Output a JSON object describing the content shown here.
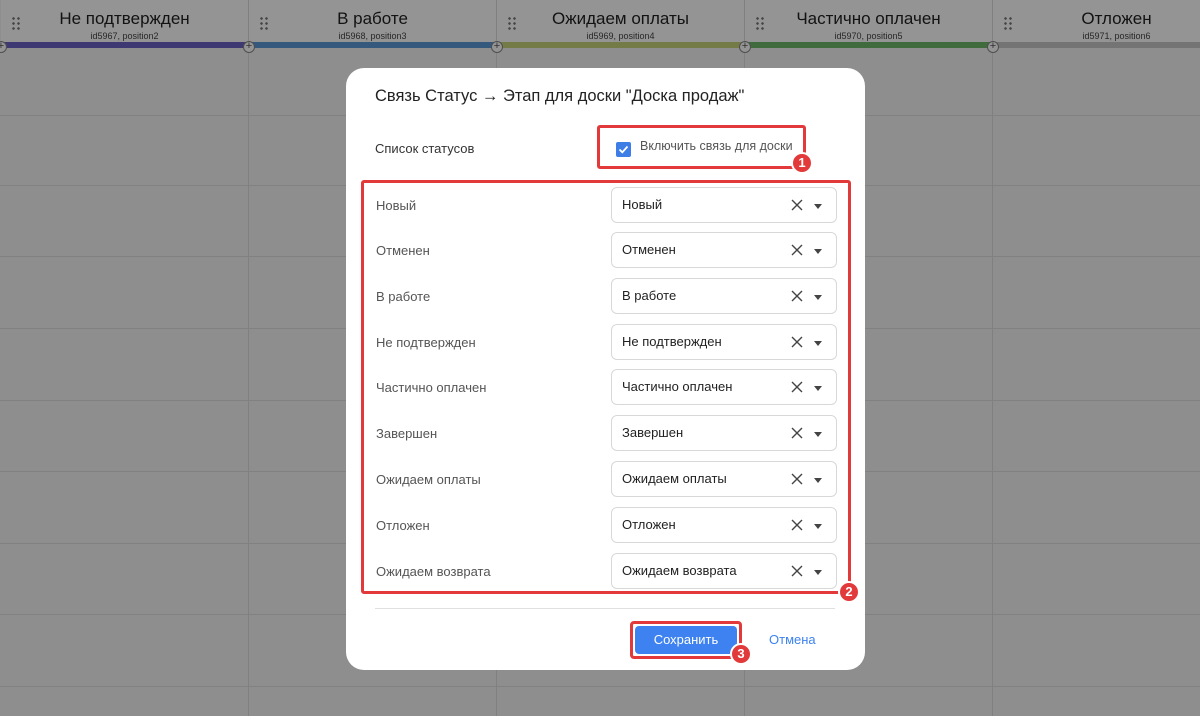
{
  "board": {
    "columns": [
      {
        "title": "Не подтвержден",
        "sub": "id5967, position2",
        "color": "#6b63c4"
      },
      {
        "title": "В работе",
        "sub": "id5968, position3",
        "color": "#5b9ad6"
      },
      {
        "title": "Ожидаем оплаты",
        "sub": "id5969, position4",
        "color": "#c9d57a"
      },
      {
        "title": "Частично оплачен",
        "sub": "id5970, position5",
        "color": "#6fb868"
      },
      {
        "title": "Отложен",
        "sub": "id5971, position6",
        "color": "#c8c8c8"
      }
    ]
  },
  "modal": {
    "title": "Связь Статус → Этап для доски \"Доска продаж\"",
    "list_label": "Список статусов",
    "toggle": {
      "label": "Включить связь для доски",
      "checked": true
    },
    "rows": [
      {
        "label": "Новый",
        "value": "Новый"
      },
      {
        "label": "Отменен",
        "value": "Отменен"
      },
      {
        "label": "В работе",
        "value": "В работе"
      },
      {
        "label": "Не подтвержден",
        "value": "Не подтвержден"
      },
      {
        "label": "Частично оплачен",
        "value": "Частично оплачен"
      },
      {
        "label": "Завершен",
        "value": "Завершен"
      },
      {
        "label": "Ожидаем оплаты",
        "value": "Ожидаем оплаты"
      },
      {
        "label": "Отложен",
        "value": "Отложен"
      },
      {
        "label": "Ожидаем возврата",
        "value": "Ожидаем возврата"
      }
    ],
    "save_label": "Сохранить",
    "cancel_label": "Отмена"
  },
  "annotations": [
    "1",
    "2",
    "3"
  ],
  "colors": {
    "accent": "#3d82f0",
    "highlight": "#e23a3a"
  }
}
